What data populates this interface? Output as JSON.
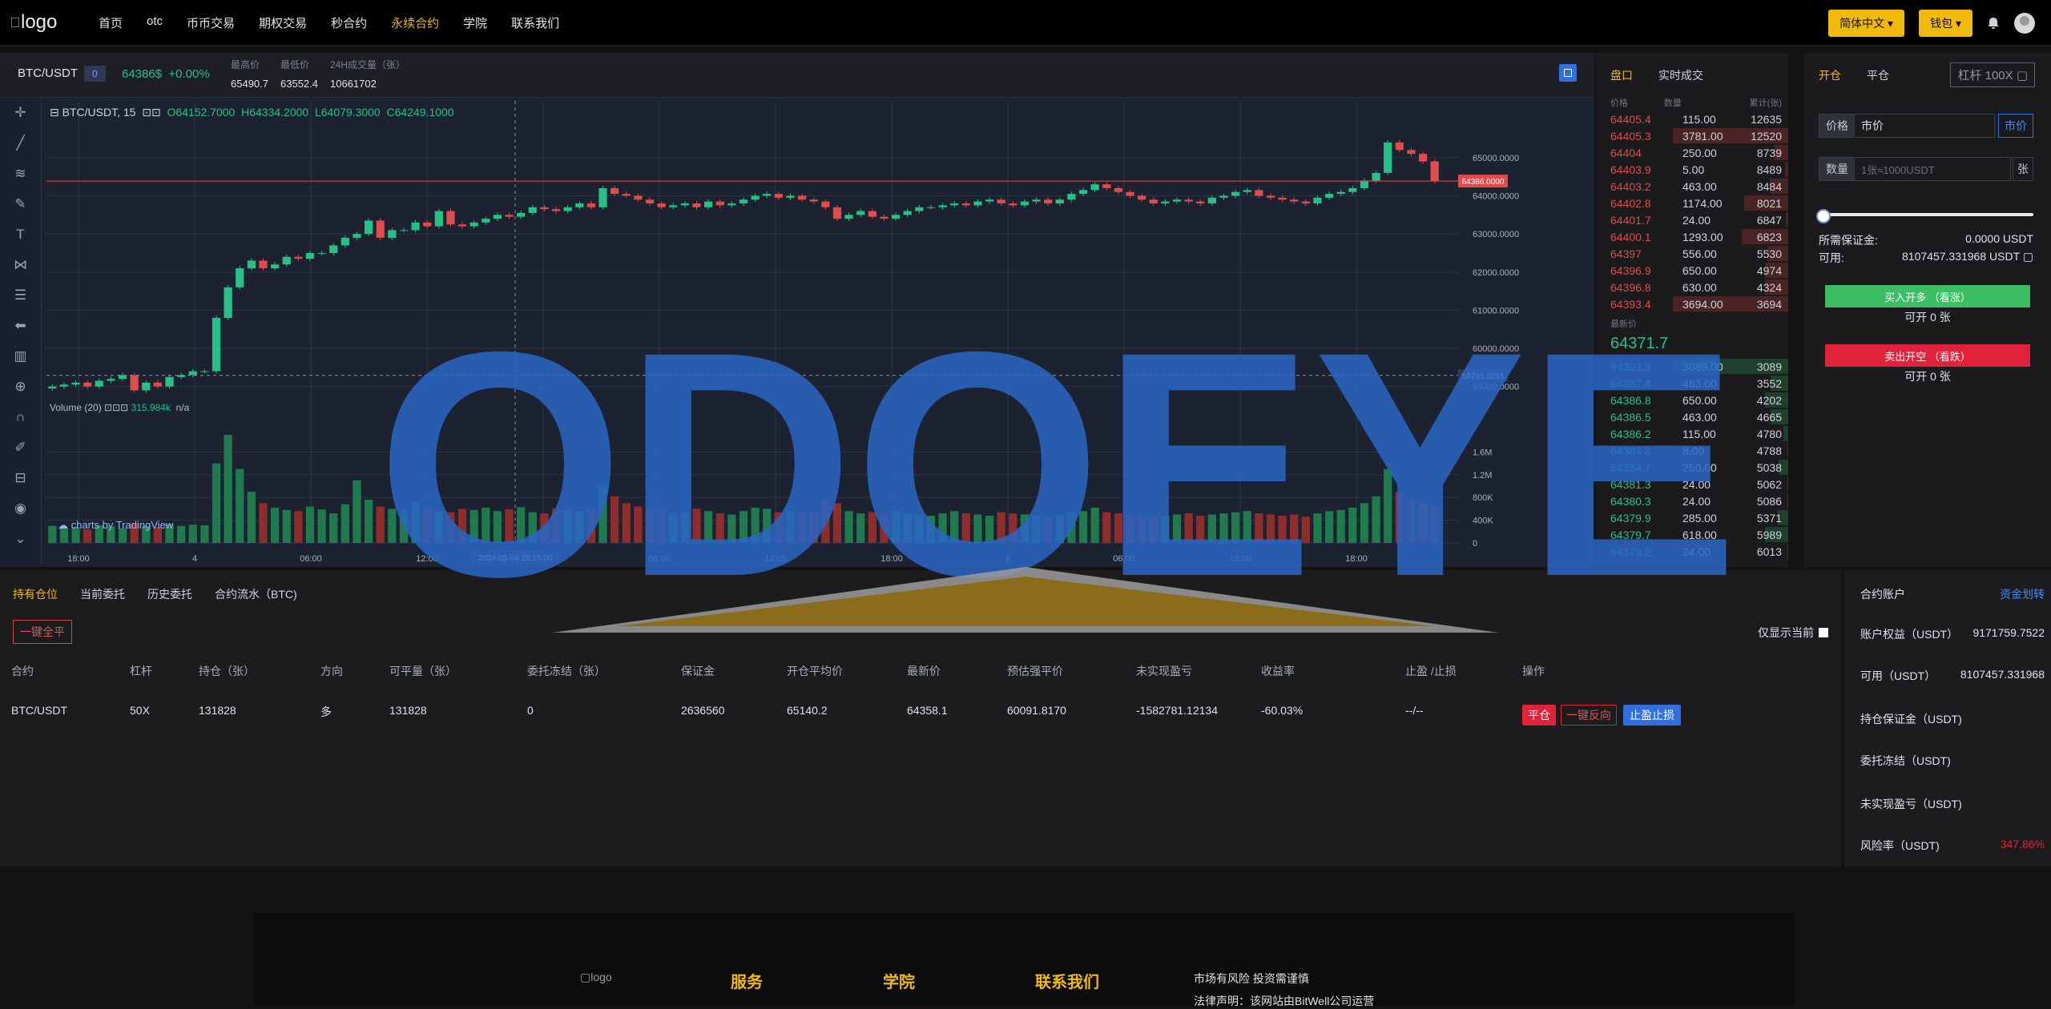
{
  "nav": {
    "logo_alt": "logo",
    "items": [
      "首页",
      "otc",
      "币币交易",
      "期权交易",
      "秒合约",
      "永续合约",
      "学院",
      "联系我们"
    ],
    "active": "永续合约"
  },
  "header_right": {
    "lang": "简体中文 ▾",
    "wallet": "钱包 ▾",
    "bell_icon": "bell-icon",
    "avatar_icon": "user-avatar-icon"
  },
  "ticker": {
    "symbol": "BTC/USDT",
    "badge": "0",
    "price": "64386$",
    "change": "+0.00%",
    "high_label": "最高价",
    "high": "65490.7",
    "low_label": "最低价",
    "low": "63552.4",
    "vol_label": "24H成交量（张）",
    "vol": "10661702"
  },
  "chart_head": {
    "title": "BTC/USDT, 15",
    "o": "O64152.7000",
    "h": "H64334.2000",
    "l": "L64079.3000",
    "c": "C64249.1000",
    "volume_label": "Volume (20)",
    "volume_val": "315.984k",
    "volume_na": "n/a",
    "branding": "charts by TradingView",
    "cursor_label": "2024-05-04 19:15:00",
    "last_price_tag": "64386.0000",
    "cross_price_tag": "59291.0181"
  },
  "chart_data": {
    "type": "candlestick",
    "x_ticks": [
      "18:00",
      "4",
      "06:00",
      "12:00",
      "5",
      "06:00",
      "12:00",
      "18:00",
      "6",
      "06:00",
      "12:00",
      "18:00"
    ],
    "price_ticks": [
      "65000.0000",
      "64000.0000",
      "63000.0000",
      "62000.0000",
      "61000.0000",
      "60000.0000",
      "59000.0000"
    ],
    "volume_ticks": [
      "1.6M",
      "1.2M",
      "800K",
      "400K",
      "0"
    ],
    "ylim": [
      58300,
      65900
    ],
    "close": [
      59000,
      59050,
      59100,
      59000,
      59150,
      59200,
      59300,
      58900,
      59100,
      59000,
      59250,
      59300,
      59400,
      59400,
      60800,
      61600,
      62100,
      62300,
      62100,
      62200,
      62400,
      62350,
      62500,
      62500,
      62700,
      62900,
      63000,
      63350,
      62900,
      63100,
      63100,
      63300,
      63200,
      63600,
      63250,
      63200,
      63300,
      63400,
      63500,
      63450,
      63550,
      63700,
      63650,
      63600,
      63700,
      63800,
      63700,
      64200,
      64050,
      64000,
      63900,
      63800,
      63700,
      63750,
      63800,
      63700,
      63850,
      63750,
      63800,
      63900,
      64000,
      64050,
      63950,
      64000,
      63900,
      63850,
      63700,
      63400,
      63500,
      63600,
      63450,
      63400,
      63500,
      63600,
      63700,
      63700,
      63750,
      63800,
      63750,
      63850,
      63900,
      63800,
      63750,
      63850,
      63900,
      63800,
      63900,
      64050,
      64150,
      64300,
      64200,
      64100,
      64000,
      63900,
      63800,
      63850,
      63900,
      63850,
      63800,
      63950,
      64000,
      64100,
      64150,
      64000,
      63950,
      63900,
      63850,
      63800,
      63950,
      64050,
      64100,
      64200,
      64400,
      64600,
      65400,
      65200,
      65100,
      64900,
      64386
    ],
    "volume": [
      300,
      260,
      280,
      240,
      310,
      290,
      260,
      350,
      300,
      280,
      330,
      300,
      320,
      310,
      1400,
      1900,
      1300,
      900,
      700,
      620,
      580,
      560,
      640,
      590,
      520,
      680,
      1100,
      760,
      640,
      600,
      580,
      720,
      610,
      560,
      540,
      600,
      580,
      620,
      560,
      590,
      630,
      540,
      520,
      610,
      580,
      560,
      600,
      1000,
      820,
      700,
      640,
      600,
      560,
      520,
      540,
      600,
      560,
      520,
      500,
      560,
      620,
      600,
      540,
      560,
      520,
      540,
      760,
      700,
      560,
      520,
      540,
      500,
      560,
      520,
      500,
      480,
      520,
      560,
      520,
      500,
      480,
      540,
      520,
      500,
      480,
      460,
      500,
      540,
      560,
      620,
      540,
      520,
      500,
      480,
      460,
      480,
      500,
      520,
      480,
      500,
      520,
      540,
      560,
      520,
      500,
      480,
      500,
      460,
      520,
      560,
      580,
      620,
      700,
      820,
      1300,
      900,
      760,
      700,
      640
    ]
  },
  "drawing_tools": [
    "crosshair-icon",
    "trendline-icon",
    "fib-icon",
    "brush-icon",
    "text-icon",
    "pattern-icon",
    "ruler-icon",
    "arrow-back-icon",
    "stats-icon",
    "zoom-icon",
    "magnet-icon",
    "lock-pen-icon",
    "lock-icon",
    "eye-icon",
    "chevron-down-icon"
  ],
  "orderbook": {
    "tabs": [
      "盘口",
      "实时成交"
    ],
    "cols": [
      "价格",
      "数量",
      "累计(张)"
    ],
    "asks": [
      {
        "p": "64405.4",
        "q": "115.00",
        "c": "12635",
        "d": 0.0
      },
      {
        "p": "64405.3",
        "q": "3781.00",
        "c": "12520",
        "d": 1.0
      },
      {
        "p": "64404",
        "q": "250.00",
        "c": "8739",
        "d": 0.12
      },
      {
        "p": "64403.9",
        "q": "5.00",
        "c": "8489",
        "d": 0.03
      },
      {
        "p": "64403.2",
        "q": "463.00",
        "c": "8484",
        "d": 0.16
      },
      {
        "p": "64402.8",
        "q": "1174.00",
        "c": "8021",
        "d": 0.38
      },
      {
        "p": "64401.7",
        "q": "24.00",
        "c": "6847",
        "d": 0.02
      },
      {
        "p": "64400.1",
        "q": "1293.00",
        "c": "6823",
        "d": 0.4
      },
      {
        "p": "64397",
        "q": "556.00",
        "c": "5530",
        "d": 0.18
      },
      {
        "p": "64396.9",
        "q": "650.00",
        "c": "4974",
        "d": 0.2
      },
      {
        "p": "64396.8",
        "q": "630.00",
        "c": "4324",
        "d": 0.2
      },
      {
        "p": "64393.4",
        "q": "3694.00",
        "c": "3694",
        "d": 1.0
      }
    ],
    "latest_label": "最新价",
    "latest": "64371.7",
    "bids": [
      {
        "p": "64393.3",
        "q": "3089.00",
        "c": "3089",
        "d": 1.0
      },
      {
        "p": "64387.4",
        "q": "463.00",
        "c": "3552",
        "d": 0.15
      },
      {
        "p": "64386.8",
        "q": "650.00",
        "c": "4202",
        "d": 0.2
      },
      {
        "p": "64386.5",
        "q": "463.00",
        "c": "4665",
        "d": 0.15
      },
      {
        "p": "64386.2",
        "q": "115.00",
        "c": "4780",
        "d": 0.04
      },
      {
        "p": "64384.8",
        "q": "8.00",
        "c": "4788",
        "d": 0.01
      },
      {
        "p": "64384.7",
        "q": "250.00",
        "c": "5038",
        "d": 0.08
      },
      {
        "p": "64381.3",
        "q": "24.00",
        "c": "5062",
        "d": 0.01
      },
      {
        "p": "64380.3",
        "q": "24.00",
        "c": "5086",
        "d": 0.01
      },
      {
        "p": "64379.9",
        "q": "285.00",
        "c": "5371",
        "d": 0.09
      },
      {
        "p": "64379.7",
        "q": "618.00",
        "c": "5989",
        "d": 0.2
      },
      {
        "p": "64379.2",
        "q": "24.00",
        "c": "6013",
        "d": 0.01
      }
    ]
  },
  "trade": {
    "tabs": [
      "开仓",
      "平仓"
    ],
    "leverage": "杠杆 100X",
    "price_label": "价格",
    "price_value": "市价",
    "market_btn": "市价",
    "qty_label": "数量",
    "qty_placeholder": "1张≈1000USDT",
    "qty_unit": "张",
    "margin_label": "所需保证金:",
    "margin_value": "0.0000 USDT",
    "avail_label": "可用:",
    "avail_value": "8107457.331968 USDT",
    "buy_btn": "买入开多 （看涨）",
    "buy_can": "可开 0 张",
    "sell_btn": "卖出开空 （看跌）",
    "sell_can": "可开 0 张",
    "buy_color": "#3cbf64",
    "sell_color": "#e0223a"
  },
  "positions": {
    "tabs": [
      "持有仓位",
      "当前委托",
      "历史委托",
      "合约流水（BTC)"
    ],
    "close_all": "一键全平",
    "only_current": "仅显示当前",
    "headers": [
      "合约",
      "杠杆",
      "持仓（张）",
      "方向",
      "可平量（张）",
      "委托冻结（张）",
      "保证金",
      "开仓平均价",
      "最新价",
      "预估强平价",
      "未实现盈亏",
      "收益率",
      "止盈 /止损",
      "操作"
    ],
    "row": [
      "BTC/USDT",
      "50X",
      "131828",
      "多",
      "131828",
      "0",
      "2636560",
      "65140.2",
      "64358.1",
      "60091.8170",
      "-1582781.12134",
      "-60.03%",
      "--/--"
    ],
    "actions": [
      "平仓",
      "一键反向",
      "止盈止损"
    ]
  },
  "account": {
    "title": "合约账户",
    "transfer": "资金划转",
    "rows": [
      {
        "k": "账户权益（USDT）",
        "v": "9171759.7522"
      },
      {
        "k": "可用（USDT）",
        "v": "8107457.331968"
      },
      {
        "k": "持仓保证金（USDT)",
        "v": ""
      },
      {
        "k": "委托冻结（USDT)",
        "v": ""
      },
      {
        "k": "未实现盈亏（USDT)",
        "v": ""
      },
      {
        "k": "风险率（USDT)",
        "v": "347.86%"
      }
    ]
  },
  "footer": {
    "logo_alt": "logo",
    "cols": [
      "服务",
      "学院",
      "联系我们"
    ],
    "risk": "市场有风险 投资需谨慎",
    "legal": "法律声明：该网站由BitWell公司运营"
  },
  "watermark": {
    "text": "ODOEYE",
    "color": "#2a66c4"
  }
}
